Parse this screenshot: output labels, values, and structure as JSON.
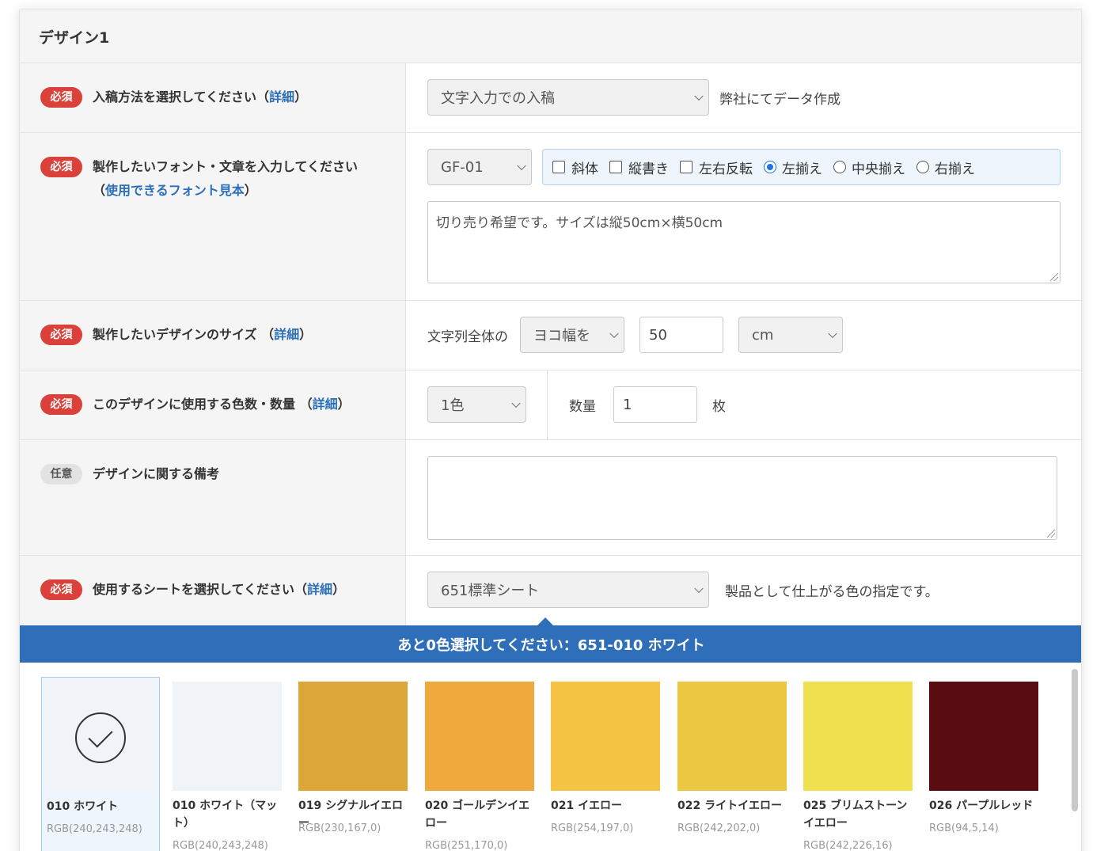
{
  "panel": {
    "title": "デザイン1"
  },
  "rows": {
    "method": {
      "badge": "必須",
      "label": "入稿方法を選択してください（",
      "link": "詳細",
      "suffix": "）",
      "select_value": "文字入力での入稿",
      "note": "弊社にてデータ作成"
    },
    "font": {
      "badge": "必須",
      "label_line1": "製作したいフォント・文章を入力してください",
      "label_line2_prefix": "（",
      "link": "使用できるフォント見本",
      "label_line2_suffix": "）",
      "font_select": "GF-01",
      "options": [
        {
          "type": "checkbox",
          "label": "斜体",
          "checked": false
        },
        {
          "type": "checkbox",
          "label": "縦書き",
          "checked": false
        },
        {
          "type": "checkbox",
          "label": "左右反転",
          "checked": false
        },
        {
          "type": "radio",
          "label": "左揃え",
          "checked": true
        },
        {
          "type": "radio",
          "label": "中央揃え",
          "checked": false
        },
        {
          "type": "radio",
          "label": "右揃え",
          "checked": false
        }
      ],
      "text_value": "切り売り希望です。サイズは縦50cm×横50cm"
    },
    "size": {
      "badge": "必須",
      "label": "製作したいデザインのサイズ （",
      "link": "詳細",
      "suffix": "）",
      "prefix_text": "文字列全体の",
      "direction_select": "ヨコ幅を",
      "size_value": "50",
      "unit_select": "cm"
    },
    "colors": {
      "badge": "必須",
      "label": "このデザインに使用する色数・数量 （",
      "link": "詳細",
      "suffix": "）",
      "color_count_select": "1色",
      "quantity_label": "数量",
      "quantity_value": "1",
      "unit": "枚"
    },
    "notes": {
      "badge": "任意",
      "label": "デザインに関する備考",
      "value": ""
    },
    "sheet": {
      "badge": "必須",
      "label": "使用するシートを選択してください（",
      "link": "詳細",
      "suffix": "）",
      "select_value": "651標準シート",
      "note": "製品として仕上がる色の指定です。"
    }
  },
  "color_bar": {
    "text": "あと0色選択してください：651-010 ホワイト"
  },
  "swatches": [
    {
      "name": "010 ホワイト",
      "rgb": "RGB(240,243,248)",
      "color": "#f0f3f8",
      "selected": true
    },
    {
      "name": "010 ホワイト（マット）",
      "rgb": "RGB(240,243,248)",
      "color": "#f0f3f8",
      "selected": false
    },
    {
      "name": "019 シグナルイエロー",
      "rgb": "RGB(230,167,0)",
      "color": "#dda738",
      "selected": false
    },
    {
      "name": "020 ゴールデンイエロー",
      "rgb": "RGB(251,170,0)",
      "color": "#eeaa3c",
      "selected": false
    },
    {
      "name": "021 イエロー",
      "rgb": "RGB(254,197,0)",
      "color": "#f6c444",
      "selected": false
    },
    {
      "name": "022 ライトイエロー",
      "rgb": "RGB(242,202,0)",
      "color": "#ebc842",
      "selected": false
    },
    {
      "name": "025 ブリムストーンイエロー",
      "rgb": "RGB(242,226,16)",
      "color": "#eee04e",
      "selected": false
    },
    {
      "name": "026 パープルレッド",
      "rgb": "RGB(94,5,14)",
      "color": "#5a0d11",
      "selected": false
    }
  ]
}
